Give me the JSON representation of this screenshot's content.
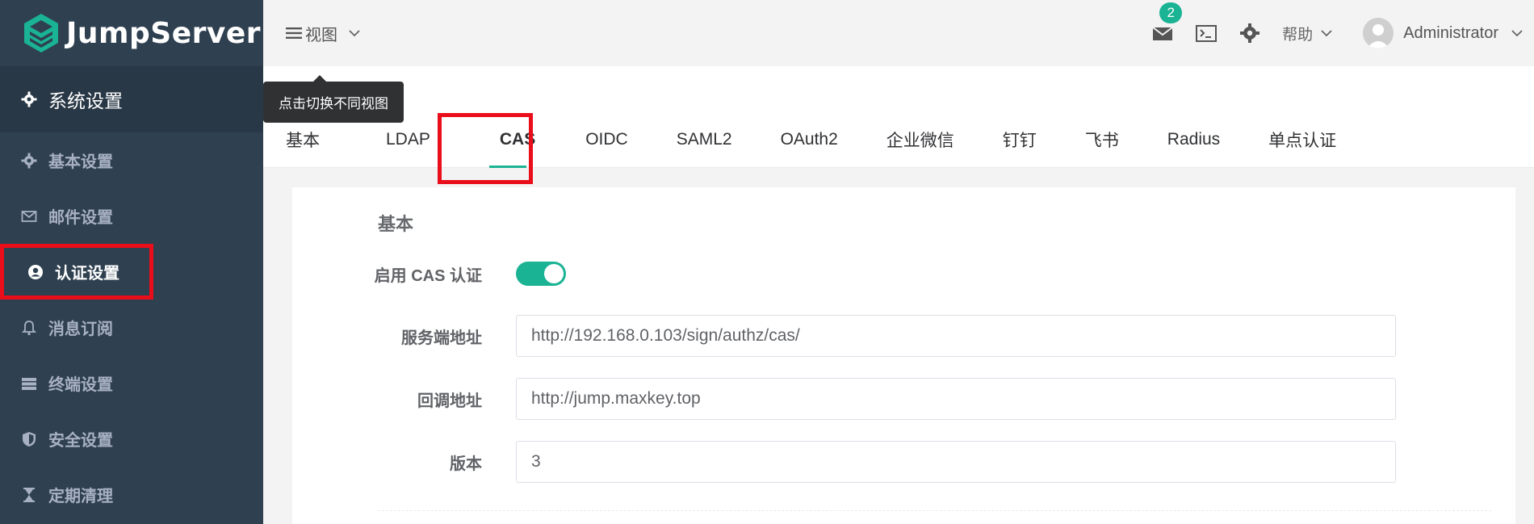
{
  "brand": {
    "name": "JumpServer"
  },
  "sidebar": {
    "header": "系统设置",
    "items": [
      {
        "label": "基本设置",
        "icon": "gear-icon"
      },
      {
        "label": "邮件设置",
        "icon": "envelope-icon"
      },
      {
        "label": "认证设置",
        "icon": "user-circle-icon",
        "active": true
      },
      {
        "label": "消息订阅",
        "icon": "bell-icon"
      },
      {
        "label": "终端设置",
        "icon": "server-icon"
      },
      {
        "label": "安全设置",
        "icon": "shield-icon"
      },
      {
        "label": "定期清理",
        "icon": "hourglass-icon"
      }
    ]
  },
  "topbar": {
    "view_label": "视图",
    "tooltip": "点击切换不同视图",
    "mail_badge": "2",
    "help_label": "帮助",
    "user_name": "Administrator"
  },
  "tabs": [
    "基本",
    "LDAP",
    "CAS",
    "OIDC",
    "SAML2",
    "OAuth2",
    "企业微信",
    "钉钉",
    "飞书",
    "Radius",
    "单点认证"
  ],
  "active_tab": "CAS",
  "form": {
    "section_title": "基本",
    "enable_label": "启用 CAS 认证",
    "enable_value": true,
    "server_url_label": "服务端地址",
    "server_url_value": "http://192.168.0.103/sign/authz/cas/",
    "callback_label": "回调地址",
    "callback_value": "http://jump.maxkey.top",
    "version_label": "版本",
    "version_value": "3"
  },
  "colors": {
    "accent": "#1ab394",
    "sidebar": "#2f4050",
    "highlight": "#ea0d1a"
  }
}
